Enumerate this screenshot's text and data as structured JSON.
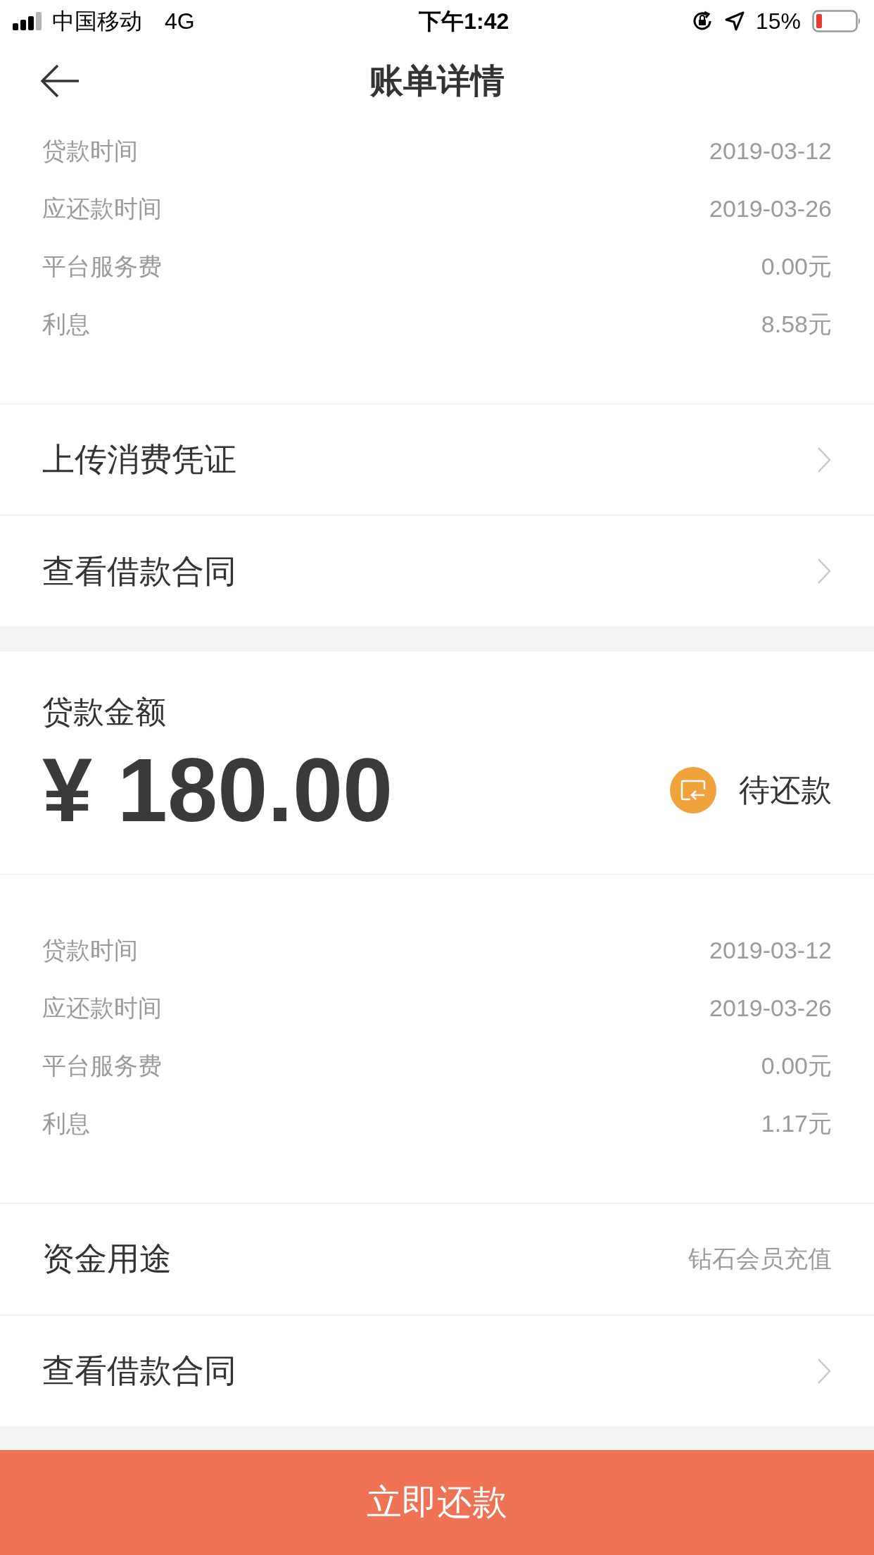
{
  "status_bar": {
    "carrier": "中国移动",
    "network": "4G",
    "time": "下午1:42",
    "battery": "15%"
  },
  "nav": {
    "title": "账单详情"
  },
  "top_details": [
    {
      "label": "贷款时间",
      "value": "2019-03-12"
    },
    {
      "label": "应还款时间",
      "value": "2019-03-26"
    },
    {
      "label": "平台服务费",
      "value": "0.00元"
    },
    {
      "label": "利息",
      "value": "8.58元"
    }
  ],
  "top_links": [
    {
      "label": "上传消费凭证"
    },
    {
      "label": "查看借款合同"
    }
  ],
  "loan": {
    "label": "贷款金额",
    "amount": "¥ 180.00",
    "status": "待还款"
  },
  "details": [
    {
      "label": "贷款时间",
      "value": "2019-03-12"
    },
    {
      "label": "应还款时间",
      "value": "2019-03-26"
    },
    {
      "label": "平台服务费",
      "value": "0.00元"
    },
    {
      "label": "利息",
      "value": "1.17元"
    }
  ],
  "rows": [
    {
      "kind": "value",
      "label": "资金用途",
      "value": "钻石会员充值"
    },
    {
      "kind": "link",
      "label": "查看借款合同"
    }
  ],
  "button": "立即还款"
}
